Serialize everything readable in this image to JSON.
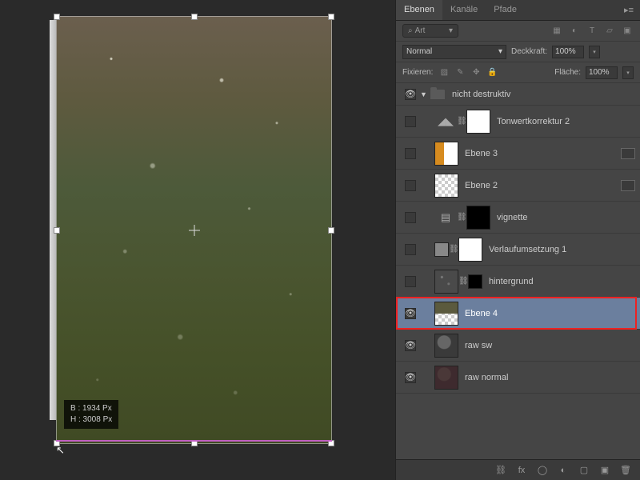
{
  "dimensions": {
    "width": "B : 1934 Px",
    "height": "H : 3008 Px"
  },
  "panel": {
    "tabs": {
      "layers": "Ebenen",
      "channels": "Kanäle",
      "paths": "Pfade"
    },
    "search_placeholder": "Art",
    "blend_mode": "Normal",
    "opacity_label": "Deckkraft:",
    "opacity_value": "100%",
    "lock_label": "Fixieren:",
    "fill_label": "Fläche:",
    "fill_value": "100%"
  },
  "layers": {
    "group_name": "nicht destruktiv",
    "items": [
      {
        "name": "Tonwertkorrektur 2"
      },
      {
        "name": "Ebene 3"
      },
      {
        "name": "Ebene 2"
      },
      {
        "name": "vignette"
      },
      {
        "name": "Verlaufumsetzung 1"
      },
      {
        "name": "hintergrund"
      },
      {
        "name": "Ebene 4"
      },
      {
        "name": "raw sw"
      },
      {
        "name": "raw normal"
      }
    ]
  }
}
